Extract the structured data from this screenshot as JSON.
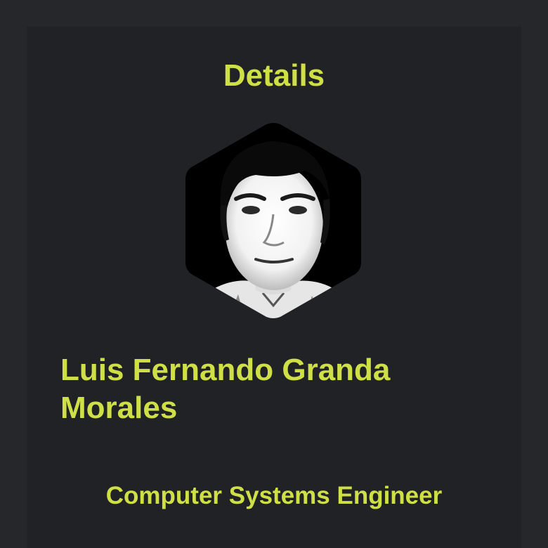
{
  "profile": {
    "heading": "Details",
    "full_name": "Luis Fernando Granda Morales",
    "occupation": "Computer Systems Engineer",
    "avatar": "profile-photo-hexagon"
  },
  "colors": {
    "page_background": "#26272b",
    "card_background": "#212226",
    "accent_text": "#cfe047",
    "avatar_background": "#000000"
  }
}
